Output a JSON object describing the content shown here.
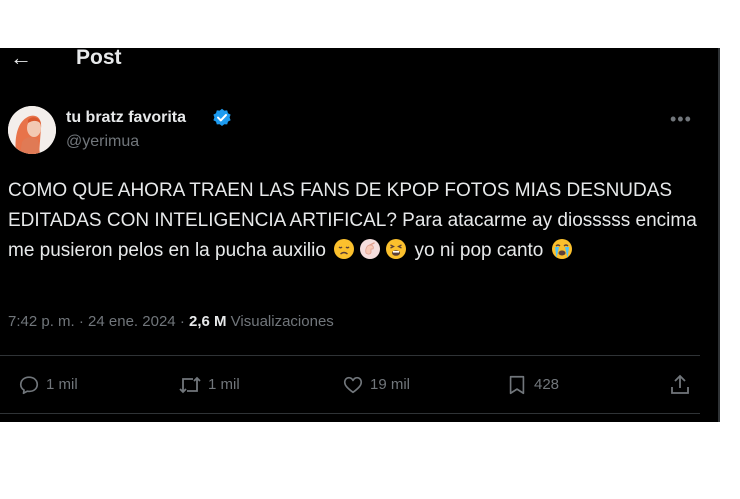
{
  "header": {
    "back_icon": "back-arrow-icon",
    "title": "Post"
  },
  "author": {
    "display_name": "tu bratz favorita",
    "handle": "@yerimua",
    "verified_color": "#1d9bf0"
  },
  "tweet": {
    "text_main": "COMO QUE AHORA TRAEN LAS FANS DE KPOP FOTOS MIAS DESNUDAS EDITADAS CON INTELIGENCIA ARTIFICAL? Para atacarme ay diosssss encima me pusieron pelos en la pucha auxilio",
    "text_tail": "yo ni pop canto"
  },
  "meta": {
    "time": "7:42 p. m.",
    "separator": "·",
    "date": "24 ene. 2024",
    "views_count": "2,6 M",
    "views_label": "Visualizaciones"
  },
  "actions": {
    "replies": "1 mil",
    "reposts": "1 mil",
    "likes": "19 mil",
    "bookmarks": "428"
  },
  "colors": {
    "background": "#000000",
    "text": "#e7e9ea",
    "secondary": "#71767b",
    "divider": "#2f3336"
  }
}
